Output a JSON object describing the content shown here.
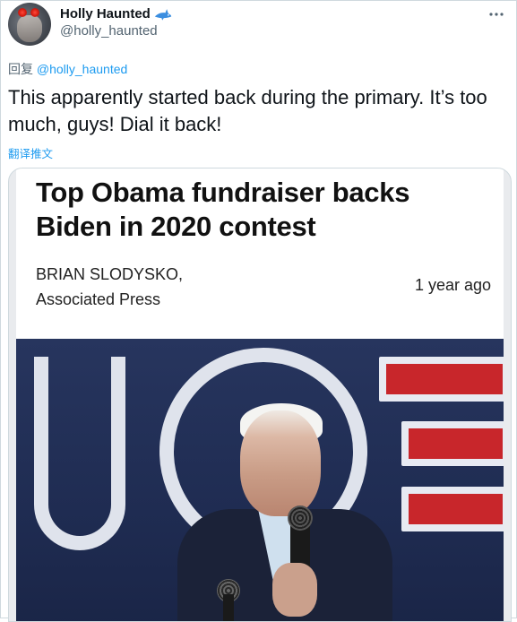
{
  "tweet": {
    "display_name": "Holly Haunted",
    "handle": "@holly_haunted",
    "reply_prefix": "回复",
    "reply_to": "@holly_haunted",
    "text": "This apparently started back during the primary. It’s too much, guys! Dial it back!",
    "translate_label": "翻译推文",
    "badge_icon": "shark-icon",
    "more_icon": "more-options-icon"
  },
  "media": {
    "headline": "Top Obama fundraiser backs Biden in 2020 contest",
    "author_line1": "BRIAN SLODYSKO,",
    "author_line2": "Associated Press",
    "time_ago": "1 year ago"
  },
  "colors": {
    "link": "#1d9bf0",
    "secondary_text": "#536471",
    "border": "#cfd9de",
    "photo_background": "#27355e",
    "banner_red": "#c8262b"
  }
}
